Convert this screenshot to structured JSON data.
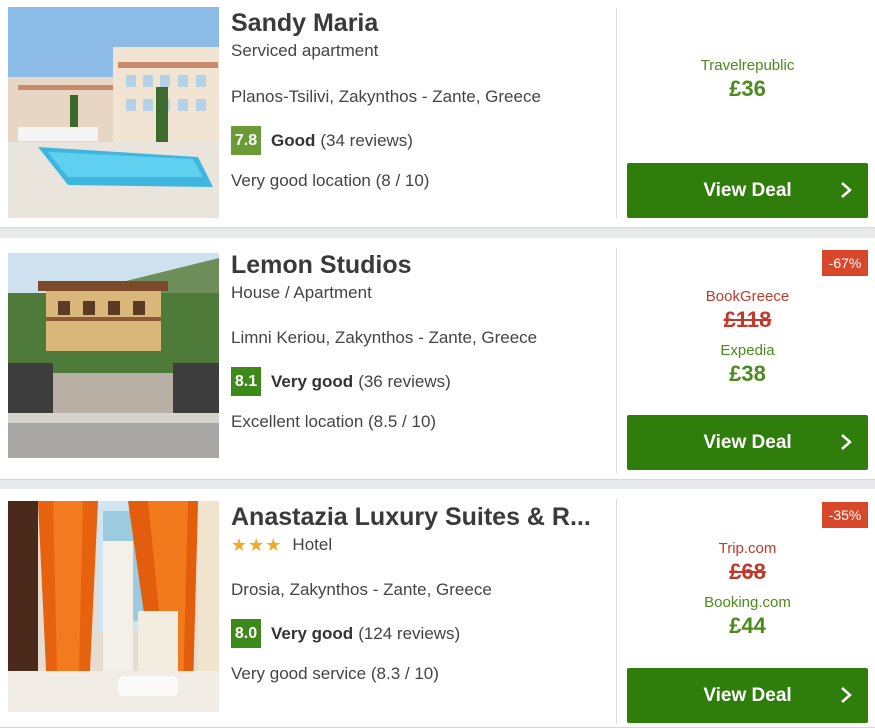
{
  "results": [
    {
      "name": "Sandy Maria",
      "type": "Serviced apartment",
      "stars": "",
      "location": "Planos-Tsilivi, Zakynthos - Zante, Greece",
      "score": "7.8",
      "rating_label": "Good",
      "reviews": "(34 reviews)",
      "sub_rating": "Very good location (8 / 10)",
      "discount": "",
      "old_provider": "",
      "old_price": "",
      "provider": "Travelrepublic",
      "price": "£36",
      "cta": "View Deal"
    },
    {
      "name": "Lemon Studios",
      "type": "House / Apartment",
      "stars": "",
      "location": "Limni Keriou, Zakynthos - Zante, Greece",
      "score": "8.1",
      "rating_label": "Very good",
      "reviews": "(36 reviews)",
      "sub_rating": "Excellent location (8.5 / 10)",
      "discount": "-67%",
      "old_provider": "BookGreece",
      "old_price": "£118",
      "provider": "Expedia",
      "price": "£38",
      "cta": "View Deal"
    },
    {
      "name": "Anastazia Luxury Suites & R...",
      "type": "Hotel",
      "stars": "★★★",
      "location": "Drosia, Zakynthos - Zante, Greece",
      "score": "8.0",
      "rating_label": "Very good",
      "reviews": "(124 reviews)",
      "sub_rating": "Very good service (8.3 / 10)",
      "discount": "-35%",
      "old_provider": "Trip.com",
      "old_price": "£68",
      "provider": "Booking.com",
      "price": "£44",
      "cta": "View Deal"
    }
  ],
  "colors": {
    "primary_green": "#2f7d0b",
    "price_green": "#4b8a1c",
    "strike_red": "#c0392b",
    "discount_red": "#d9472b",
    "score_good": "#6a9b36",
    "score_very_good": "#3d8a1b",
    "star_orange": "#f0a92b"
  },
  "icons": {
    "cta_icon": "chevron-right-icon",
    "star_icon": "star-icon"
  }
}
